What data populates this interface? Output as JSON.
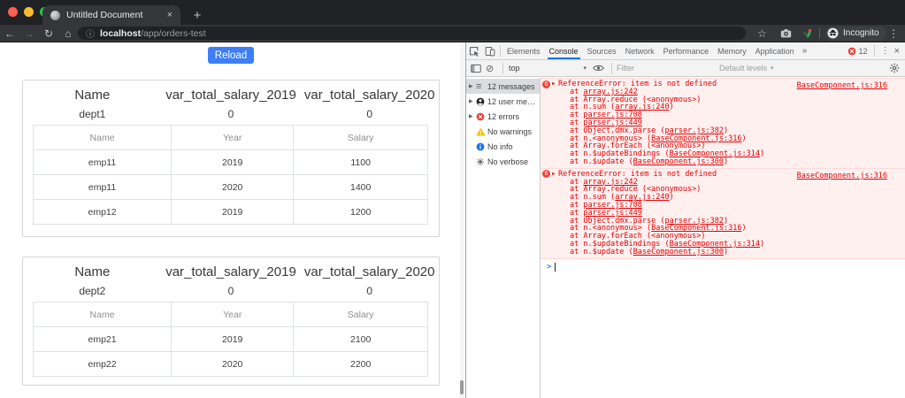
{
  "browser": {
    "tab": {
      "title": "Untitled Document"
    },
    "url": {
      "host": "localhost",
      "path": "/app/orders-test"
    },
    "incognito_label": "Incognito"
  },
  "icons": {
    "tab_close": "×",
    "new_tab": "+",
    "back": "←",
    "forward": "→",
    "reload": "↻",
    "home": "⌂",
    "url_info": "ⓘ",
    "bookmark_star": "☆",
    "menu_dots": "⋮",
    "devtools_menu_dots": "⋮",
    "devtools_close": "×",
    "clear_console": "⊘",
    "dropdown_caret": "▾",
    "expand_caret": "▶",
    "list_icon": "≡",
    "prompt_chevron": ">"
  },
  "page": {
    "reload_button": "Reload",
    "cards": [
      {
        "headers": [
          "Name",
          "var_total_salary_2019",
          "var_total_salary_2020"
        ],
        "summary": [
          "dept1",
          "0",
          "0"
        ],
        "columns": [
          "Name",
          "Year",
          "Salary"
        ],
        "rows": [
          [
            "emp11",
            "2019",
            "1100"
          ],
          [
            "emp11",
            "2020",
            "1400"
          ],
          [
            "emp12",
            "2019",
            "1200"
          ]
        ]
      },
      {
        "headers": [
          "Name",
          "var_total_salary_2019",
          "var_total_salary_2020"
        ],
        "summary": [
          "dept2",
          "0",
          "0"
        ],
        "columns": [
          "Name",
          "Year",
          "Salary"
        ],
        "rows": [
          [
            "emp21",
            "2019",
            "2100"
          ],
          [
            "emp22",
            "2020",
            "2200"
          ]
        ]
      }
    ]
  },
  "devtools": {
    "tabs": [
      "Elements",
      "Console",
      "Sources",
      "Network",
      "Performance",
      "Memory",
      "Application"
    ],
    "selected_tab": "Console",
    "more_tabs": "»",
    "error_badge_count": "12",
    "toolbar": {
      "context": "top",
      "filter_placeholder": "Filter",
      "levels": "Default levels"
    },
    "sidebar": [
      {
        "label": "12 messages"
      },
      {
        "label": "12 user me…"
      },
      {
        "label": "12 errors"
      },
      {
        "label": "No warnings"
      },
      {
        "label": "No info"
      },
      {
        "label": "No verbose"
      }
    ],
    "errors": [
      {
        "repeat_count": "6",
        "message": "ReferenceError: item is not defined",
        "source_link": "BaseComponent.js:316",
        "stack": [
          {
            "pre": "at ",
            "link": "array.js:242",
            "post": ""
          },
          {
            "pre": "at Array.reduce (<anonymous>)",
            "link": "",
            "post": ""
          },
          {
            "pre": "at n.sum (",
            "link": "array.js:240",
            "post": ")"
          },
          {
            "pre": "at ",
            "link": "parser.js:708",
            "post": ""
          },
          {
            "pre": "at ",
            "link": "parser.js:449",
            "post": ""
          },
          {
            "pre": "at Object.dmx.parse (",
            "link": "parser.js:382",
            "post": ")"
          },
          {
            "pre": "at n.<anonymous> (",
            "link": "BaseComponent.js:316",
            "post": ")"
          },
          {
            "pre": "at Array.forEach (<anonymous>)",
            "link": "",
            "post": ""
          },
          {
            "pre": "at n.$updateBindings (",
            "link": "BaseComponent.js:314",
            "post": ")"
          },
          {
            "pre": "at n.$update (",
            "link": "BaseComponent.js:300",
            "post": ")"
          }
        ]
      },
      {
        "repeat_count": "6",
        "message": "ReferenceError: item is not defined",
        "source_link": "BaseComponent.js:316",
        "stack": [
          {
            "pre": "at ",
            "link": "array.js:242",
            "post": ""
          },
          {
            "pre": "at Array.reduce (<anonymous>)",
            "link": "",
            "post": ""
          },
          {
            "pre": "at n.sum (",
            "link": "array.js:240",
            "post": ")"
          },
          {
            "pre": "at ",
            "link": "parser.js:708",
            "post": ""
          },
          {
            "pre": "at ",
            "link": "parser.js:449",
            "post": ""
          },
          {
            "pre": "at Object.dmx.parse (",
            "link": "parser.js:382",
            "post": ")"
          },
          {
            "pre": "at n.<anonymous> (",
            "link": "BaseComponent.js:316",
            "post": ")"
          },
          {
            "pre": "at Array.forEach (<anonymous>)",
            "link": "",
            "post": ""
          },
          {
            "pre": "at n.$updateBindings (",
            "link": "BaseComponent.js:314",
            "post": ")"
          },
          {
            "pre": "at n.$update (",
            "link": "BaseComponent.js:300",
            "post": ")"
          }
        ]
      }
    ]
  },
  "colors": {
    "accent_blue": "#3b7ef8",
    "devtools_tab_underline": "#1a73e8",
    "error_red": "#e60000",
    "error_bg": "#fff0f0",
    "error_border": "#ffd9d9",
    "badge_red": "#e8453c"
  }
}
